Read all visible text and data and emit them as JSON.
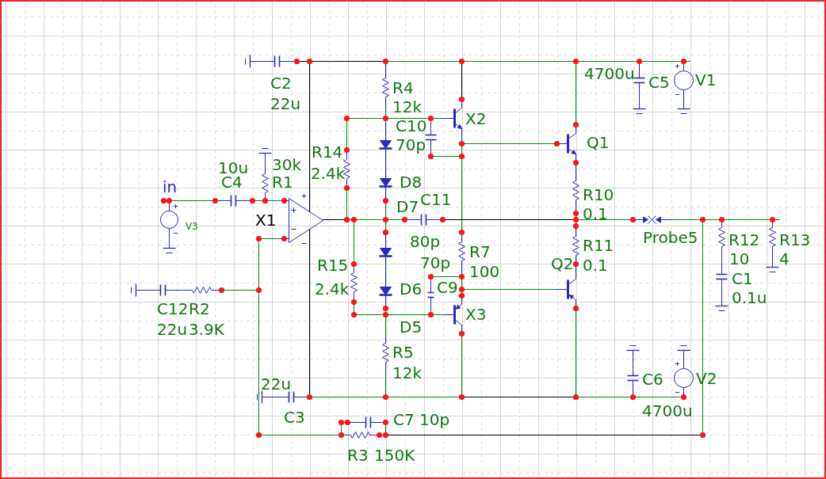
{
  "schematic": {
    "net_labels": [
      {
        "text": "in"
      }
    ],
    "components": [
      {
        "kind": "capacitor",
        "ref": "C2",
        "value": "22u",
        "color": "#0f7a0f"
      },
      {
        "kind": "resistor",
        "ref": "R4",
        "value": "12k",
        "color": "#0f7a0f"
      },
      {
        "kind": "capacitor",
        "ref": "C5",
        "value": "4700u",
        "color": "#0f7a0f"
      },
      {
        "kind": "voltage_source",
        "ref": "V1",
        "color": "#0f7a0f"
      },
      {
        "kind": "capacitor",
        "ref": "C4",
        "value": "10u",
        "color": "#0f7a0f"
      },
      {
        "kind": "resistor",
        "ref": "R1",
        "value": "30k",
        "color": "#0f7a0f"
      },
      {
        "kind": "resistor",
        "ref": "R14",
        "value": "2.4k",
        "color": "#0f7a0f"
      },
      {
        "kind": "capacitor",
        "ref": "C10",
        "value": "70p",
        "color": "#0f7a0f"
      },
      {
        "kind": "npn",
        "ref": "X2",
        "color": "#0f7a0f"
      },
      {
        "kind": "npn",
        "ref": "Q1",
        "color": "#0f7a0f"
      },
      {
        "kind": "diode",
        "ref": "D8",
        "color": "#0f7a0f"
      },
      {
        "kind": "voltage_source",
        "ref": "V3",
        "color": "#0f7a0f"
      },
      {
        "kind": "op_amp",
        "ref": "X1",
        "color": "#000000"
      },
      {
        "kind": "diode",
        "ref": "D7",
        "color": "#0f7a0f"
      },
      {
        "kind": "capacitor",
        "ref": "C11",
        "value": "80p",
        "color": "#0f7a0f"
      },
      {
        "kind": "resistor",
        "ref": "R10",
        "value": "0.1",
        "color": "#0f7a0f"
      },
      {
        "kind": "resistor",
        "ref": "R7",
        "value": "100",
        "color": "#0f7a0f"
      },
      {
        "kind": "pnp",
        "ref": "Q2",
        "color": "#0f7a0f"
      },
      {
        "kind": "resistor",
        "ref": "R11",
        "value": "0.1",
        "color": "#0f7a0f"
      },
      {
        "kind": "probe",
        "ref": "Probe5",
        "color": "#0f7a0f"
      },
      {
        "kind": "resistor",
        "ref": "R12",
        "value": "10",
        "color": "#0f7a0f"
      },
      {
        "kind": "resistor",
        "ref": "R13",
        "value": "4",
        "color": "#0f7a0f"
      },
      {
        "kind": "resistor",
        "ref": "R15",
        "value": "2.4k",
        "color": "#0f7a0f"
      },
      {
        "kind": "diode",
        "ref": "D6",
        "color": "#0f7a0f"
      },
      {
        "kind": "capacitor",
        "ref": "C9",
        "value": "70p",
        "color": "#0f7a0f"
      },
      {
        "kind": "capacitor",
        "ref": "C1",
        "value": "0.1u",
        "color": "#0f7a0f"
      },
      {
        "kind": "capacitor",
        "ref": "C12",
        "value": "22u",
        "color": "#0f7a0f"
      },
      {
        "kind": "resistor",
        "ref": "R2",
        "value": "3.9K",
        "color": "#0f7a0f"
      },
      {
        "kind": "diode",
        "ref": "D5",
        "color": "#0f7a0f"
      },
      {
        "kind": "pnp",
        "ref": "X3",
        "color": "#0f7a0f"
      },
      {
        "kind": "capacitor",
        "ref": "C3",
        "value": "22u",
        "color": "#0f7a0f"
      },
      {
        "kind": "resistor",
        "ref": "R5",
        "value": "12k",
        "color": "#0f7a0f"
      },
      {
        "kind": "capacitor",
        "ref": "C7",
        "value": "10p",
        "color": "#0f7a0f"
      },
      {
        "kind": "capacitor",
        "ref": "C6",
        "value": "4700u",
        "color": "#0f7a0f"
      },
      {
        "kind": "voltage_source",
        "ref": "V2",
        "color": "#0f7a0f"
      },
      {
        "kind": "resistor",
        "ref": "R3",
        "value": "150K",
        "color": "#0f7a0f"
      }
    ]
  }
}
